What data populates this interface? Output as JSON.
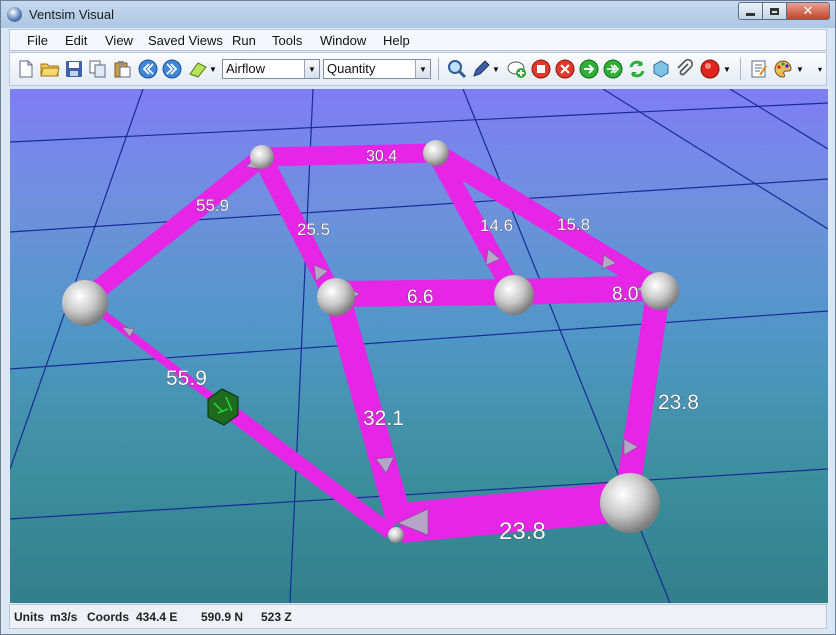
{
  "window": {
    "title": "Ventsim Visual"
  },
  "menu": [
    "File",
    "Edit",
    "View",
    "Saved Views",
    "Run",
    "Tools",
    "Window",
    "Help"
  ],
  "toolbar": {
    "display_select": "Airflow",
    "value_select": "Quantity"
  },
  "icons": {
    "new": "new-file-icon",
    "open": "open-folder-icon",
    "save": "save-icon",
    "copy": "copy-icon",
    "paste": "paste-icon",
    "back": "back-icon",
    "forward": "forward-icon",
    "dropdown": "chevron-down-icon",
    "zoom": "zoom-icon",
    "pen": "pen-icon",
    "add": "add-node-icon",
    "stop": "stop-icon",
    "delete": "delete-icon",
    "go": "go-icon",
    "green": "run-icon",
    "refresh": "refresh-icon",
    "shape": "shape-icon",
    "clip": "paperclip-icon",
    "record": "record-icon",
    "notes": "notes-icon",
    "palette": "palette-icon"
  },
  "colors": {
    "airway": "#e625e6",
    "node": "#c8c8c8",
    "fan": "#1e6a1e"
  },
  "airways": [
    {
      "label": "30.4",
      "font": 16
    },
    {
      "label": "55.9",
      "font": 17
    },
    {
      "label": "25.5",
      "font": 17
    },
    {
      "label": "14.6",
      "font": 17
    },
    {
      "label": "15.8",
      "font": 17
    },
    {
      "label": "6.6",
      "font": 19
    },
    {
      "label": "8.0",
      "font": 19
    },
    {
      "label": "55.9",
      "font": 21
    },
    {
      "label": "32.1",
      "font": 21
    },
    {
      "label": "23.8",
      "font": 21
    },
    {
      "label": "23.8",
      "font": 24
    }
  ],
  "status": {
    "units_label": "Units",
    "units_value": "m3/s",
    "coords_label": "Coords",
    "east": "434.4 E",
    "north": "590.9 N",
    "z": "523 Z"
  }
}
